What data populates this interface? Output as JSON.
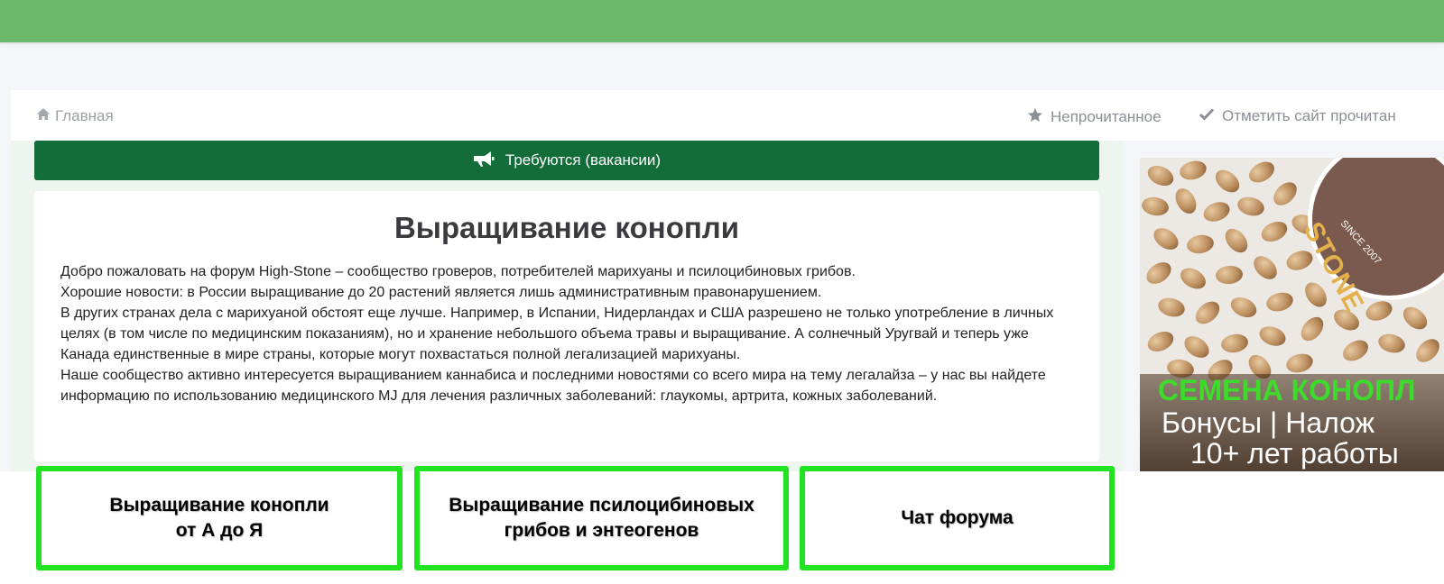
{
  "nav": {
    "home_label": "Главная",
    "unread_label": "Непрочитанное",
    "mark_read_label": "Отметить сайт прочитан"
  },
  "announcement": {
    "label": "Требуются (вакансии)"
  },
  "content": {
    "title": "Выращивание конопли",
    "paragraphs": [
      "Добро пожаловать на форум High-Stone – сообщество гроверов, потребителей марихуаны и псилоцибиновых грибов.",
      "Хорошие новости: в России выращивание до 20 растений является лишь административным правонарушением.",
      "В других странах дела с марихуаной обстоят еще лучше. Например, в Испании, Нидерландах и США разрешено не только употребление в личных целях (в том числе по медицинским показаниям), но и хранение небольшого объема травы и выращивание. А солнечный Уругвай и теперь уже Канада единственные в мире страны, которые могут похвастаться полной легализацией марихуаны.",
      "Наше сообщество активно интересуется выращиванием каннабиса и последними новостями со всего мира на тему легалайза – у нас вы найдете информацию по использованию медицинского MJ для лечения различных заболеваний: глаукомы, артрита, кожных заболеваний."
    ]
  },
  "banner": {
    "brand": "STONE",
    "since": "SINCE 2007",
    "line1": "СЕМЕНА КОНОПЛ",
    "line2": "Бонусы | Налож",
    "line3": "10+ лет работы"
  },
  "categories": [
    {
      "line1": "Выращивание конопли",
      "line2": "от А до Я"
    },
    {
      "line1": "Выращивание псилоцибиновых",
      "line2": "грибов и энтеогенов"
    },
    {
      "line1": "Чат форума",
      "line2": ""
    }
  ],
  "colors": {
    "top_bar": "#6bb86b",
    "announce_bg": "#126d39",
    "category_border": "#21e321",
    "banner_green": "#3ddc2a"
  },
  "icons": {
    "home": "home-icon",
    "unread": "star-icon",
    "mark_read": "check-icon",
    "announce": "megaphone-icon"
  }
}
